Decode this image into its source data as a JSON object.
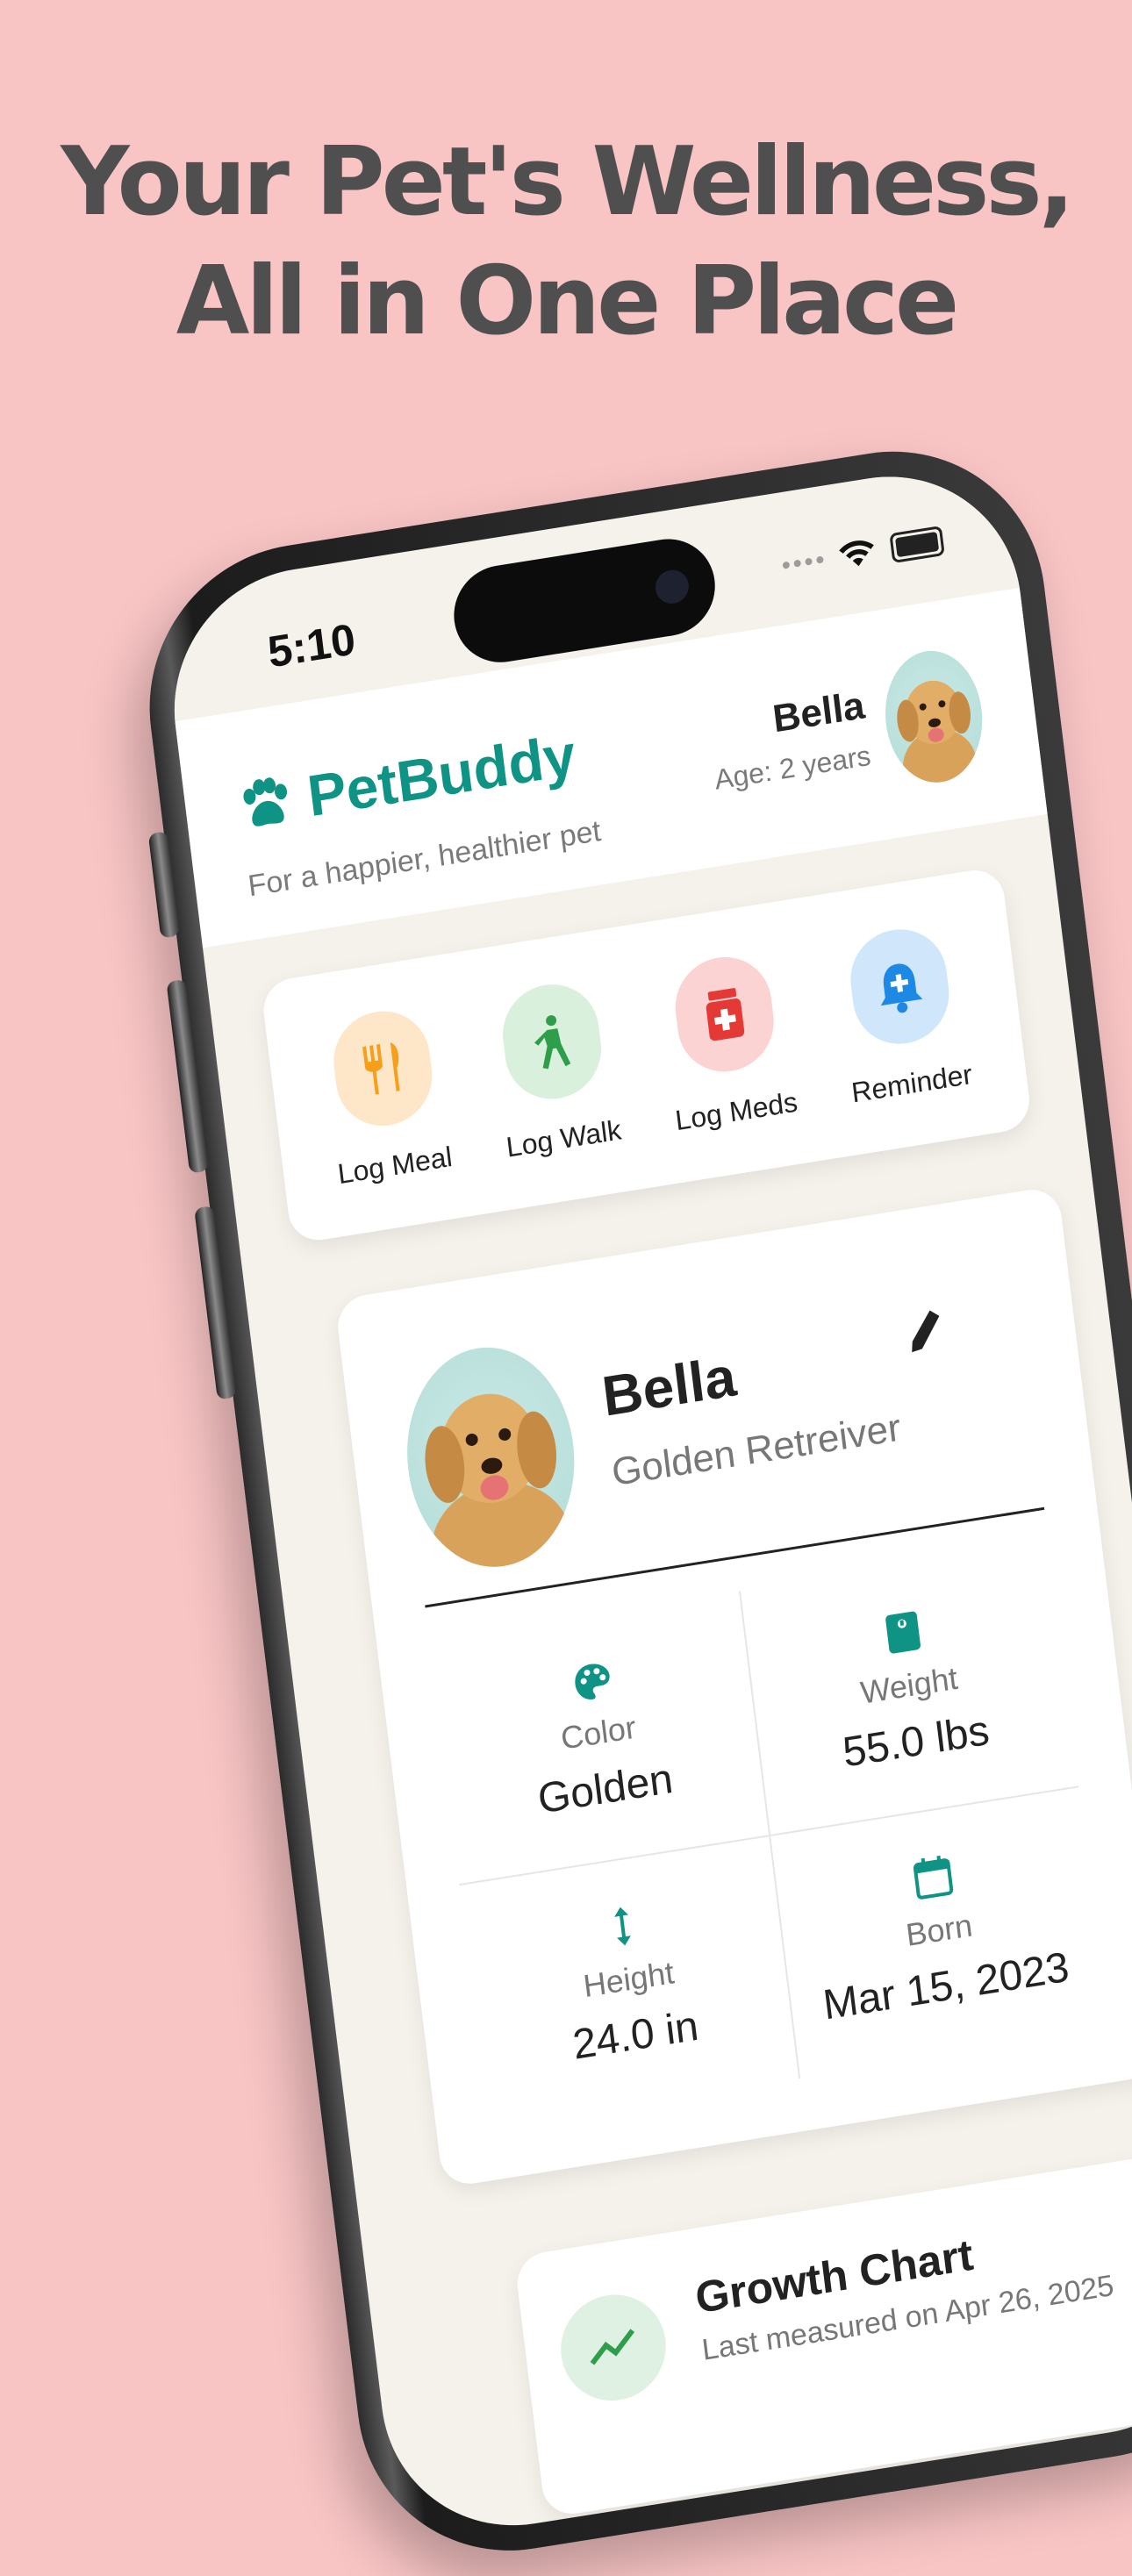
{
  "headline": {
    "line1": "Your Pet's Wellness,",
    "line2": "All in One Place"
  },
  "status_bar": {
    "time": "5:10",
    "icons": [
      "signal-icon",
      "wifi-icon",
      "battery-icon"
    ]
  },
  "header": {
    "app_name": "PetBuddy",
    "tagline": "For a happier, healthier pet",
    "pet_name": "Bella",
    "pet_age": "Age: 2 years"
  },
  "quick_actions": [
    {
      "label": "Log Meal",
      "icon": "fork-knife-icon",
      "color": "#f59f1b",
      "bg": "#fde7c8"
    },
    {
      "label": "Log Walk",
      "icon": "walking-person-icon",
      "color": "#2e9e4b",
      "bg": "#d9f0dc"
    },
    {
      "label": "Log Meds",
      "icon": "medicine-bottle-icon",
      "color": "#e53935",
      "bg": "#fbd3d3"
    },
    {
      "label": "Reminder",
      "icon": "bell-icon",
      "color": "#1e88e5",
      "bg": "#cfe6fb"
    }
  ],
  "profile": {
    "name": "Bella",
    "breed": "Golden Retreiver",
    "stats": {
      "color": {
        "label": "Color",
        "value": "Golden",
        "icon": "palette-icon"
      },
      "weight": {
        "label": "Weight",
        "value": "55.0 lbs",
        "icon": "scale-icon"
      },
      "height": {
        "label": "Height",
        "value": "24.0 in",
        "icon": "vertical-arrows-icon"
      },
      "born": {
        "label": "Born",
        "value": "Mar 15, 2023",
        "icon": "calendar-icon"
      }
    }
  },
  "growth_chart": {
    "title": "Growth Chart",
    "subtitle": "Last measured on Apr 26, 2025"
  },
  "colors": {
    "background": "#f8c4c4",
    "brand": "#0e9384",
    "headline": "#4f4f4f",
    "screen_bg": "#f5f1eb"
  }
}
